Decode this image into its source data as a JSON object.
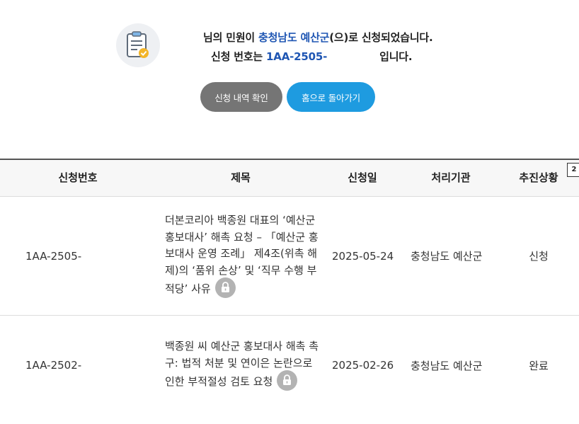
{
  "notice": {
    "line1_suffix": "님의 민원이 ",
    "agency": "충청남도 예산군",
    "line1_end": "(으)로 신청되었습니다.",
    "line2_prefix": "신청 번호는 ",
    "application_number": "1AA-2505-",
    "line2_end": "입니다."
  },
  "buttons": {
    "view_history": "신청 내역 확인",
    "go_home": "홈으로 돌아가기"
  },
  "table": {
    "headers": [
      "신청번호",
      "제목",
      "신청일",
      "처리기관",
      "추진상황"
    ],
    "corner_badge": "2",
    "rows": [
      {
        "number": "1AA-2505-",
        "title": "더본코리아 백종원 대표의 ‘예산군 홍보대사’ 해촉 요청 – 「예산군 홍보대사 운영 조례」 제4조(위촉 해제)의 ‘품위 손상’ 및 ‘직무 수행 부적당’ 사유",
        "date": "2025-05-24",
        "org": "충청남도 예산군",
        "status": "신청"
      },
      {
        "number": "1AA-2502-",
        "title": "백종원 씨 예산군 홍보대사 해촉 촉구: 법적 처분 및 연이은 논란으로 인한 부적절성 검토 요청",
        "date": "2025-02-26",
        "org": "충청남도 예산군",
        "status": "완료"
      }
    ]
  },
  "icons": {
    "notice": "clipboard-check-icon",
    "private": "lock-icon"
  },
  "colors": {
    "highlight": "#1f56b3",
    "primary_button": "#1e9be0",
    "secondary_button": "#757575"
  }
}
